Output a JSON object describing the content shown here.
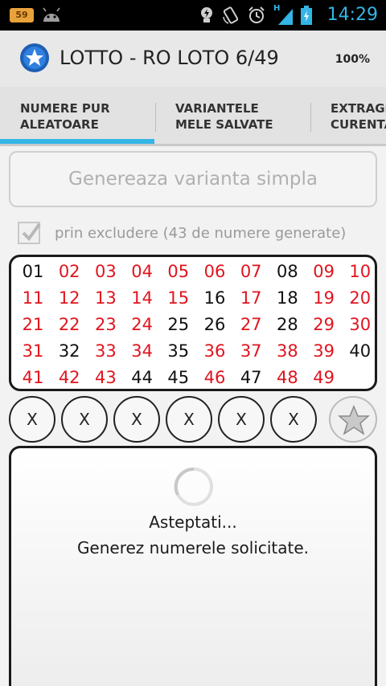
{
  "statusbar": {
    "notification_count": "59",
    "network_label": "H",
    "time": "14:29",
    "accent_color": "#33b5e5"
  },
  "actionbar": {
    "title": "LOTTO - RO LOTO 6/49",
    "percent": "100%"
  },
  "tabs": [
    {
      "label": "NUMERE PUR\nALEATOARE",
      "selected": true
    },
    {
      "label": "VARIANTELE\nMELE SALVATE",
      "selected": false
    },
    {
      "label": "EXTRAGE\nCURENTA",
      "selected": false
    }
  ],
  "generate_button": {
    "label": "Genereaza varianta simpla"
  },
  "exclusion": {
    "label": "prin excludere (43 de numere generate)",
    "checked": true
  },
  "numbers": [
    {
      "n": "01",
      "red": false
    },
    {
      "n": "02",
      "red": true
    },
    {
      "n": "03",
      "red": true
    },
    {
      "n": "04",
      "red": true
    },
    {
      "n": "05",
      "red": true
    },
    {
      "n": "06",
      "red": true
    },
    {
      "n": "07",
      "red": true
    },
    {
      "n": "08",
      "red": false
    },
    {
      "n": "09",
      "red": true
    },
    {
      "n": "10",
      "red": true
    },
    {
      "n": "11",
      "red": true
    },
    {
      "n": "12",
      "red": true
    },
    {
      "n": "13",
      "red": true
    },
    {
      "n": "14",
      "red": true
    },
    {
      "n": "15",
      "red": true
    },
    {
      "n": "16",
      "red": false
    },
    {
      "n": "17",
      "red": true
    },
    {
      "n": "18",
      "red": false
    },
    {
      "n": "19",
      "red": true
    },
    {
      "n": "20",
      "red": true
    },
    {
      "n": "21",
      "red": true
    },
    {
      "n": "22",
      "red": true
    },
    {
      "n": "23",
      "red": true
    },
    {
      "n": "24",
      "red": true
    },
    {
      "n": "25",
      "red": false
    },
    {
      "n": "26",
      "red": false
    },
    {
      "n": "27",
      "red": true
    },
    {
      "n": "28",
      "red": false
    },
    {
      "n": "29",
      "red": true
    },
    {
      "n": "30",
      "red": true
    },
    {
      "n": "31",
      "red": true
    },
    {
      "n": "32",
      "red": false
    },
    {
      "n": "33",
      "red": true
    },
    {
      "n": "34",
      "red": true
    },
    {
      "n": "35",
      "red": false
    },
    {
      "n": "36",
      "red": true
    },
    {
      "n": "37",
      "red": true
    },
    {
      "n": "38",
      "red": true
    },
    {
      "n": "39",
      "red": true
    },
    {
      "n": "40",
      "red": false
    },
    {
      "n": "41",
      "red": true
    },
    {
      "n": "42",
      "red": true
    },
    {
      "n": "43",
      "red": true
    },
    {
      "n": "44",
      "red": false
    },
    {
      "n": "45",
      "red": false
    },
    {
      "n": "46",
      "red": true
    },
    {
      "n": "47",
      "red": false
    },
    {
      "n": "48",
      "red": true
    },
    {
      "n": "49",
      "red": true
    }
  ],
  "number_colors": {
    "red": "#e0141e",
    "black": "#111111"
  },
  "picks": [
    "X",
    "X",
    "X",
    "X",
    "X",
    "X"
  ],
  "favorite_icon": "star-icon",
  "status": {
    "line1": "Asteptati...",
    "line2": "Generez numerele solicitate."
  }
}
